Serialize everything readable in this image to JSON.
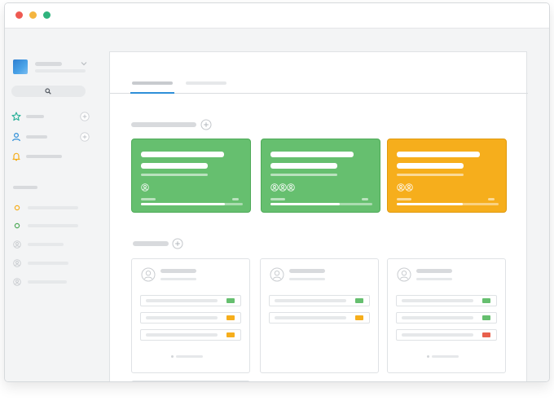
{
  "window": {
    "traffic_lights": [
      {
        "name": "close",
        "color": "#ee5a52"
      },
      {
        "name": "minimize",
        "color": "#f4b53f"
      },
      {
        "name": "zoom",
        "color": "#2fb37d"
      }
    ]
  },
  "sidebar": {
    "workspace_logo_color": "#3d8fd9",
    "workspace_icon": "chevron-down-icon",
    "search_icon": "search-icon",
    "nav_items": [
      {
        "icon": "star-icon",
        "color": "#2fb39c",
        "has_add": true
      },
      {
        "icon": "user-icon",
        "color": "#2f8fd8",
        "has_add": true
      },
      {
        "icon": "bell-icon",
        "color": "#f6ae1c",
        "has_add": false
      }
    ],
    "list_items": [
      {
        "icon": "circle-icon",
        "color": "#f6ae1c"
      },
      {
        "icon": "circle-icon",
        "color": "#4faa59"
      },
      {
        "icon": "user-avatar-icon",
        "color": "#c9ccd0"
      },
      {
        "icon": "user-avatar-icon",
        "color": "#c9ccd0"
      },
      {
        "icon": "user-avatar-icon",
        "color": "#c9ccd0"
      }
    ]
  },
  "main": {
    "active_tab_color": "#2f8fd8",
    "section_add_icon": "plus-circle-icon",
    "colored_cards": [
      {
        "color": "#66bf6f",
        "progress": 0.82,
        "avatars": 1
      },
      {
        "color": "#66bf6f",
        "progress": 0.68,
        "avatars": 3
      },
      {
        "color": "#f6ae1c",
        "progress": 0.65,
        "avatars": 2
      }
    ],
    "panels": [
      {
        "rows": [
          {
            "chip": "#66bf6f"
          },
          {
            "chip": "#f6ae1c"
          },
          {
            "chip": "#f6ae1c"
          }
        ],
        "has_footer": true
      },
      {
        "rows": [
          {
            "chip": "#66bf6f"
          },
          {
            "chip": "#f6ae1c"
          }
        ],
        "has_footer": false
      },
      {
        "rows": [
          {
            "chip": "#66bf6f"
          },
          {
            "chip": "#66bf6f"
          },
          {
            "chip": "#e8604c"
          }
        ],
        "has_footer": true
      }
    ]
  }
}
